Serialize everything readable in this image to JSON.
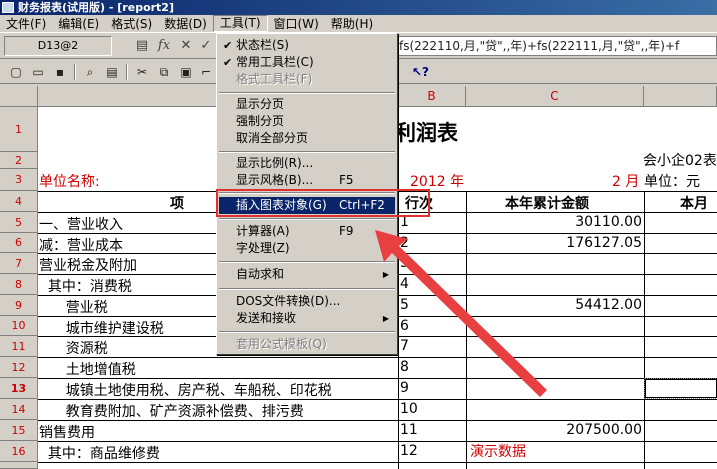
{
  "window": {
    "title": "财务报表(试用版) - [report2]"
  },
  "menu": [
    "文件(F)",
    "编辑(E)",
    "格式(S)",
    "数据(D)",
    "工具(T)",
    "窗口(W)",
    "帮助(H)"
  ],
  "formula_bar": {
    "cell_ref": "D13@2",
    "formula": "fs(222110,月,\"贷\",,年)+fs(222111,月,\"贷\",,年)+f"
  },
  "dropdown": {
    "items": [
      {
        "label": "状态栏(S)",
        "checked": true
      },
      {
        "label": "常用工具栏(C)",
        "checked": true
      },
      {
        "label": "格式工具栏(F)",
        "disabled": true
      },
      {
        "label": "显示分页"
      },
      {
        "label": "强制分页"
      },
      {
        "label": "取消全部分页"
      },
      {
        "label": "显示比例(R)..."
      },
      {
        "label": "显示风格(B)...",
        "shortcut": "F5"
      },
      {
        "label": "插入图表对象(G)",
        "shortcut": "Ctrl+F2",
        "highlighted": true
      },
      {
        "label": "计算器(A)",
        "shortcut": "F9"
      },
      {
        "label": "字处理(Z)"
      },
      {
        "label": "自动求和",
        "submenu": true
      },
      {
        "label": "DOS文件转换(D)..."
      },
      {
        "label": "发送和接收",
        "submenu": true
      },
      {
        "label": "套用公式模板(Q)",
        "disabled": true
      }
    ]
  },
  "sheet": {
    "columns": [
      "B",
      "C"
    ],
    "row_numbers": [
      "1",
      "2",
      "3",
      "4",
      "5",
      "6",
      "7",
      "8",
      "9",
      "10",
      "11",
      "12",
      "13",
      "14",
      "15",
      "16"
    ],
    "title": "利润表",
    "form_code": "会小企02表",
    "unit_label": "单位名称:",
    "year": "2012 年",
    "month": "2 月",
    "currency_unit": "单位：元",
    "headers": {
      "item": "项",
      "row_no": "行次",
      "ytd": "本年累计金额",
      "month": "本月"
    },
    "rows": [
      {
        "item": "一、营业收入",
        "no": "1",
        "ytd": "30110.00"
      },
      {
        "item": "减：营业成本",
        "no": "2",
        "ytd": "176127.05"
      },
      {
        "item": "营业税金及附加",
        "no": "3",
        "ytd": ""
      },
      {
        "item": "  其中：消费税",
        "no": "4",
        "ytd": ""
      },
      {
        "item": "      营业税",
        "no": "5",
        "ytd": "54412.00"
      },
      {
        "item": "      城市维护建设税",
        "no": "6",
        "ytd": ""
      },
      {
        "item": "      资源税",
        "no": "7",
        "ytd": ""
      },
      {
        "item": "      土地增值税",
        "no": "8",
        "ytd": ""
      },
      {
        "item": "      城镇土地使用税、房产税、车船税、印花税",
        "no": "9",
        "ytd": ""
      },
      {
        "item": "      教育费附加、矿产资源补偿费、排污费",
        "no": "10",
        "ytd": ""
      },
      {
        "item": "销售费用",
        "no": "11",
        "ytd": "207500.00"
      },
      {
        "item": "  其中：商品维修费",
        "no": "12",
        "ytd": ""
      }
    ],
    "demo_note": "演示数据"
  },
  "colors": {
    "title_bar": "#0a246a",
    "highlight": "#0a246a",
    "annotation": "#e03030"
  }
}
